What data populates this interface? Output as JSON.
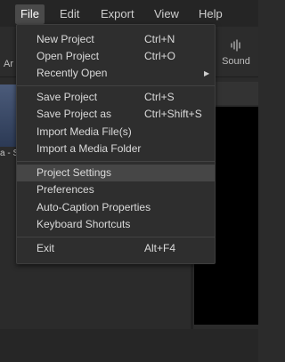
{
  "menubar": {
    "items": [
      "File",
      "Edit",
      "Export",
      "View",
      "Help"
    ]
  },
  "toolbar": {
    "left_label_partial": "Ar",
    "right_icon": "waveform-icon",
    "right_label": "Sound"
  },
  "media": {
    "thumb_caption_partial": "a - S"
  },
  "file_menu": {
    "groups": [
      [
        {
          "label": "New Project",
          "shortcut": "Ctrl+N"
        },
        {
          "label": "Open Project",
          "shortcut": "Ctrl+O"
        },
        {
          "label": "Recently Open",
          "shortcut": "",
          "submenu": true
        }
      ],
      [
        {
          "label": "Save Project",
          "shortcut": "Ctrl+S"
        },
        {
          "label": "Save Project as",
          "shortcut": "Ctrl+Shift+S"
        },
        {
          "label": "Import Media File(s)",
          "shortcut": ""
        },
        {
          "label": "Import a Media Folder",
          "shortcut": ""
        }
      ],
      [
        {
          "label": "Project Settings",
          "shortcut": "",
          "highlighted": true
        },
        {
          "label": "Preferences",
          "shortcut": ""
        },
        {
          "label": "Auto-Caption Properties",
          "shortcut": ""
        },
        {
          "label": "Keyboard Shortcuts",
          "shortcut": ""
        }
      ],
      [
        {
          "label": "Exit",
          "shortcut": "Alt+F4"
        }
      ]
    ]
  },
  "colors": {
    "menu_bg": "#2e2e2e",
    "highlight": "#464646",
    "app_bg": "#2b2b2b"
  }
}
